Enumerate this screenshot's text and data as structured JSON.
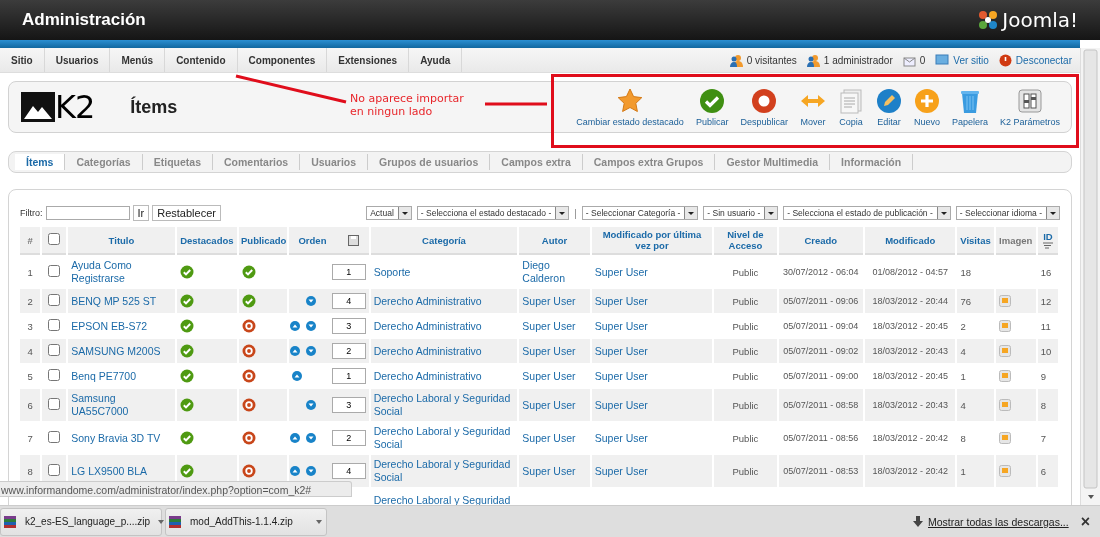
{
  "header": {
    "title": "Administración",
    "logo_text": "Joomla!"
  },
  "menu": [
    "Sitio",
    "Usuarios",
    "Menús",
    "Contenido",
    "Componentes",
    "Extensiones",
    "Ayuda"
  ],
  "status": [
    {
      "kind": "visitors",
      "label": "0 visitantes"
    },
    {
      "kind": "admins",
      "label": "1 administrador"
    },
    {
      "kind": "messages",
      "label": "0"
    },
    {
      "kind": "site",
      "label": "Ver sitio"
    },
    {
      "kind": "logout",
      "label": "Desconectar"
    }
  ],
  "page": {
    "logo_text": "K2",
    "title": "Ítems"
  },
  "annotation": {
    "text": "No aparece importar en ningun lado"
  },
  "toolbar": [
    {
      "kind": "featured",
      "label": "Cambiar estado destacado"
    },
    {
      "kind": "publish",
      "label": "Publicar"
    },
    {
      "kind": "unpublish",
      "label": "Despublicar"
    },
    {
      "kind": "move",
      "label": "Mover"
    },
    {
      "kind": "copy",
      "label": "Copia"
    },
    {
      "kind": "edit",
      "label": "Editar"
    },
    {
      "kind": "new",
      "label": "Nuevo"
    },
    {
      "kind": "trash",
      "label": "Papelera"
    },
    {
      "kind": "params",
      "label": "K2 Parámetros"
    }
  ],
  "subtabs": [
    {
      "label": "Ítems",
      "selected": true
    },
    {
      "label": "Categorías",
      "selected": false
    },
    {
      "label": "Etiquetas",
      "selected": false
    },
    {
      "label": "Comentarios",
      "selected": false
    },
    {
      "label": "Usuarios",
      "selected": false
    },
    {
      "label": "Grupos de usuarios",
      "selected": false
    },
    {
      "label": "Campos extra",
      "selected": false
    },
    {
      "label": "Campos extra Grupos",
      "selected": false
    },
    {
      "label": "Gestor Multimedia",
      "selected": false
    },
    {
      "label": "Información",
      "selected": false
    }
  ],
  "filter": {
    "label": "Filtro:",
    "go": "Ir",
    "reset": "Restablecer"
  },
  "filters": [
    {
      "kind": "select",
      "value": "Actual"
    },
    {
      "kind": "select",
      "value": "- Selecciona el estado destacado -"
    },
    {
      "kind": "separator",
      "text": "|"
    },
    {
      "kind": "select",
      "value": "- Seleccionar Categoría -"
    },
    {
      "kind": "select",
      "value": "- Sin usuario -"
    },
    {
      "kind": "select",
      "value": "- Selecciona el estado de publicación -"
    },
    {
      "kind": "select",
      "value": "- Seleccionar idioma -"
    }
  ],
  "table": {
    "columns": [
      {
        "kind": "plain",
        "label": "#"
      },
      {
        "kind": "checkbox",
        "checked": false
      },
      {
        "kind": "link",
        "label": "Titulo"
      },
      {
        "kind": "link",
        "label": "Destacados"
      },
      {
        "kind": "link",
        "label": "Publicado"
      },
      {
        "kind": "order",
        "label": "Orden"
      },
      {
        "kind": "link",
        "label": "Categoría"
      },
      {
        "kind": "link",
        "label": "Autor"
      },
      {
        "kind": "link",
        "label": "Modificado por última vez por"
      },
      {
        "kind": "link",
        "label": "Nivel de Acceso"
      },
      {
        "kind": "link",
        "label": "Creado"
      },
      {
        "kind": "link",
        "label": "Modificado"
      },
      {
        "kind": "link",
        "label": "Visitas"
      },
      {
        "kind": "plain",
        "label": "Imagen"
      },
      {
        "kind": "sort",
        "label": "ID"
      }
    ],
    "rows": [
      {
        "num": "1",
        "checked": false,
        "title": "Ayuda Como Registrarse",
        "featured": true,
        "published": true,
        "up": false,
        "down": false,
        "order": "1",
        "category": "Soporte",
        "author": "Diego Calderon",
        "modified_by": "Super User",
        "access": "Public",
        "created": "30/07/2012 - 06:04",
        "modified": "01/08/2012 - 04:57",
        "hits": "18",
        "image": false,
        "id": "16"
      },
      {
        "num": "2",
        "checked": false,
        "title": "BENQ MP 525 ST",
        "featured": true,
        "published": true,
        "up": false,
        "down": true,
        "order": "4",
        "category": "Derecho Administrativo",
        "author": "Super User",
        "modified_by": "Super User",
        "access": "Public",
        "created": "05/07/2011 - 09:06",
        "modified": "18/03/2012 - 20:44",
        "hits": "76",
        "image": true,
        "id": "12"
      },
      {
        "num": "3",
        "checked": false,
        "title": "EPSON EB-S72",
        "featured": true,
        "published": false,
        "up": true,
        "down": true,
        "order": "3",
        "category": "Derecho Administrativo",
        "author": "Super User",
        "modified_by": "Super User",
        "access": "Public",
        "created": "05/07/2011 - 09:04",
        "modified": "18/03/2012 - 20:45",
        "hits": "2",
        "image": true,
        "id": "11"
      },
      {
        "num": "4",
        "checked": false,
        "title": "SAMSUNG M200S",
        "featured": true,
        "published": false,
        "up": true,
        "down": true,
        "order": "2",
        "category": "Derecho Administrativo",
        "author": "Super User",
        "modified_by": "Super User",
        "access": "Public",
        "created": "05/07/2011 - 09:02",
        "modified": "18/03/2012 - 20:43",
        "hits": "4",
        "image": true,
        "id": "10"
      },
      {
        "num": "5",
        "checked": false,
        "title": "Benq PE7700",
        "featured": true,
        "published": false,
        "up": true,
        "down": false,
        "order": "1",
        "category": "Derecho Administrativo",
        "author": "Super User",
        "modified_by": "Super User",
        "access": "Public",
        "created": "05/07/2011 - 09:00",
        "modified": "18/03/2012 - 20:45",
        "hits": "1",
        "image": true,
        "id": "9"
      },
      {
        "num": "6",
        "checked": false,
        "title": "Samsung UA55C7000",
        "featured": true,
        "published": false,
        "up": false,
        "down": true,
        "order": "3",
        "category": "Derecho Laboral y Seguridad Social",
        "author": "Super User",
        "modified_by": "Super User",
        "access": "Public",
        "created": "05/07/2011 - 08:58",
        "modified": "18/03/2012 - 20:43",
        "hits": "4",
        "image": true,
        "id": "8"
      },
      {
        "num": "7",
        "checked": false,
        "title": "Sony Bravia 3D TV",
        "featured": true,
        "published": false,
        "up": true,
        "down": true,
        "order": "2",
        "category": "Derecho Laboral y Seguridad Social",
        "author": "Super User",
        "modified_by": "Super User",
        "access": "Public",
        "created": "05/07/2011 - 08:56",
        "modified": "18/03/2012 - 20:42",
        "hits": "8",
        "image": true,
        "id": "7"
      },
      {
        "num": "8",
        "checked": false,
        "title": "LG LX9500 BLA",
        "featured": true,
        "published": false,
        "up": true,
        "down": true,
        "order": "4",
        "category": "Derecho Laboral y Seguridad Social",
        "author": "Super User",
        "modified_by": "Super User",
        "access": "Public",
        "created": "05/07/2011 - 08:53",
        "modified": "18/03/2012 - 20:42",
        "hits": "1",
        "image": true,
        "id": "6"
      },
      {
        "category": "Derecho Laboral y Seguridad"
      }
    ]
  },
  "status_url": "www.informandome.com/administrator/index.php?option=com_k2#",
  "downloads": [
    {
      "name": "k2_es-ES_language_p....zip"
    },
    {
      "name": "mod_AddThis-1.1.4.zip"
    }
  ],
  "downloads_bar": {
    "show_all": "Mostrar todas las descargas...",
    "close": "×"
  }
}
